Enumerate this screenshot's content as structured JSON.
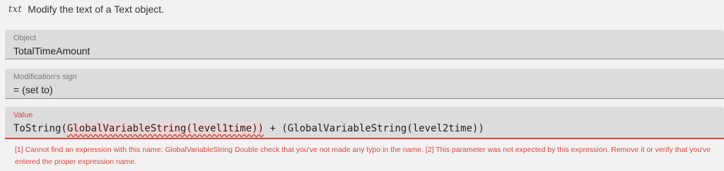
{
  "header": {
    "icon": "text-object-icon",
    "icon_glyph": "txt",
    "title": "Modify the text of a Text object."
  },
  "object_field": {
    "label": "Object",
    "value": "TotalTimeAmount"
  },
  "sign_field": {
    "label": "Modification's sign",
    "value": "= (set to)"
  },
  "value_field": {
    "label": "Value",
    "expr_prefix": "ToString(",
    "expr_error_token": "GlobalVariableString(level1time))",
    "expr_suffix": " + (GlobalVariableString(level2time))",
    "error_message": "[1] Cannot find an expression with this name: GlobalVariableString Double check that you've not made any typo in the name. [2] This parameter was not expected by this expression. Remove it or verify that you've entered the proper expression name."
  },
  "colors": {
    "error": "#d9463b",
    "field_bg": "#dcdcdc",
    "page_bg": "#f2f2f2"
  }
}
